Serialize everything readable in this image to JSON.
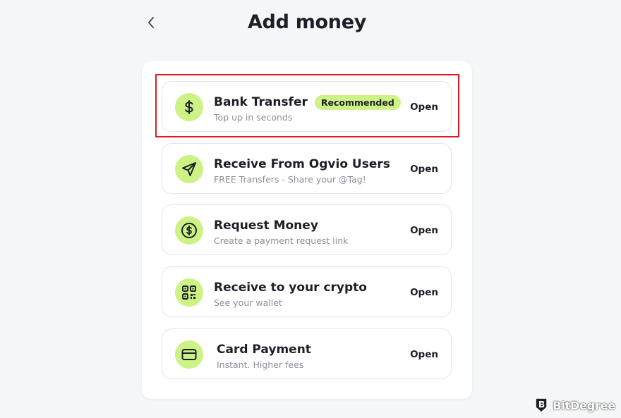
{
  "header": {
    "title": "Add money",
    "back_icon": "chevron-left-icon"
  },
  "colors": {
    "accent": "#cdf285",
    "highlight_border": "#e01b24",
    "page_bg": "#f5f6f8",
    "card_bg": "#ffffff"
  },
  "options": [
    {
      "title": "Bank Transfer",
      "badge": "Recommended",
      "subtitle": "Top up in seconds",
      "action": "Open",
      "icon": "dollar-icon"
    },
    {
      "title": "Receive From Ogvio Users",
      "subtitle": "FREE Transfers - Share your @Tag!",
      "action": "Open",
      "icon": "send-icon"
    },
    {
      "title": "Request Money",
      "subtitle": "Create a payment request link",
      "action": "Open",
      "icon": "dollar-circle-icon"
    },
    {
      "title": "Receive to your crypto",
      "subtitle": "See your wallet",
      "action": "Open",
      "icon": "qr-code-icon"
    },
    {
      "title": "Card Payment",
      "subtitle": "Instant. Higher fees",
      "action": "Open",
      "icon": "credit-card-icon"
    }
  ],
  "watermark": {
    "text": "BitDegree",
    "logo": "bitdegree-logo-icon"
  }
}
